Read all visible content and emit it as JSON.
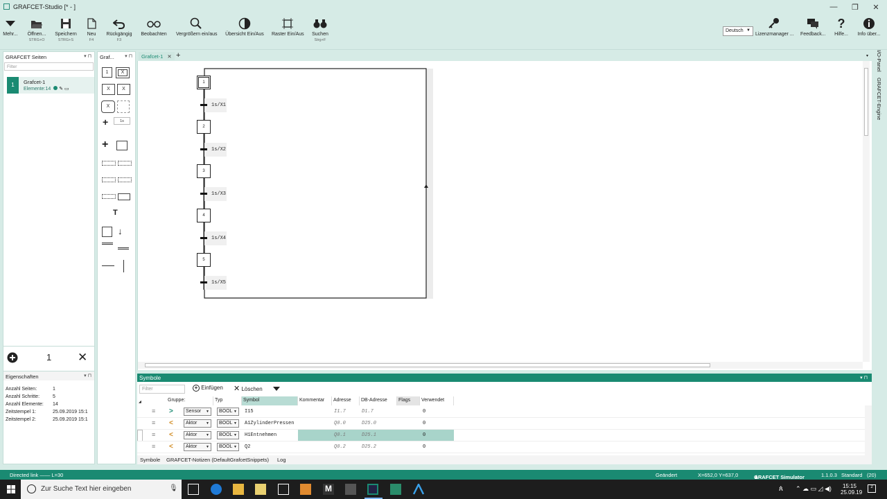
{
  "window": {
    "title": "GRAFCET-Studio [* - ]",
    "min": "—",
    "max": "❐",
    "close": "✕"
  },
  "toolbar": {
    "more": "Mehr...",
    "open": "Öffnen...",
    "open_sc": "STRG+O",
    "save": "Speichern",
    "save_sc": "STRG+S",
    "new": "Neu",
    "new_sc": "F4",
    "undo": "Rückgängig",
    "undo_sc": "F3",
    "observe": "Beobachten",
    "zoom": "Vergrößern ein/aus",
    "overview": "Übersicht Ein/Aus",
    "grid": "Raster Ein/Aus",
    "search": "Suchen",
    "search_sc": "Strg+F",
    "language": "Deutsch",
    "license": "Lizenzmanager ...",
    "feedback": "Feedback...",
    "help": "Hilfe...",
    "info": "Info über..."
  },
  "left_panel": {
    "title": "GRAFCET Seiten",
    "filter_placeholder": "Filter",
    "item_num": "1",
    "item_name": "Grafcet-1",
    "item_elements": "Elemente:14",
    "footer_count": "1"
  },
  "palette": {
    "title": "Graf...",
    "step_label": "1",
    "time_label": "1s"
  },
  "tabs": {
    "active": "Grafcet-1",
    "close": "✕",
    "add": "+"
  },
  "side_tabs": {
    "io": "I/O-Panel",
    "engine": "GRAFCET-Engine"
  },
  "grafcet": {
    "steps": [
      "1",
      "2",
      "3",
      "4",
      "5"
    ],
    "transitions": [
      "1s/X1",
      "1s/X2",
      "1s/X3",
      "1s/X4",
      "1s/X5"
    ]
  },
  "symbols": {
    "title": "Symbole",
    "filter_placeholder": "Filter",
    "insert": "Einfügen",
    "delete": "Löschen",
    "columns": [
      "Gruppe:",
      "Typ",
      "Symbol",
      "Kommentar",
      "Adresse",
      "DB-Adresse",
      "Flags",
      "Verwendet"
    ],
    "rows": [
      {
        "arrow": ">",
        "group": "Sensor",
        "type": "BOOL",
        "symbol": "I15",
        "comment": "",
        "address": "I1.7",
        "db": "D1.7",
        "flags": "",
        "used": "0"
      },
      {
        "arrow": "<",
        "group": "Aktor",
        "type": "BOOL",
        "symbol": "A1ZylinderPressen",
        "comment": "",
        "address": "Q0.0",
        "db": "D25.0",
        "flags": "",
        "used": "0"
      },
      {
        "arrow": "<",
        "group": "Aktor",
        "type": "BOOL",
        "symbol": "H1Entnehmen",
        "comment": "",
        "address": "Q0.1",
        "db": "D25.1",
        "flags": "",
        "used": "0"
      },
      {
        "arrow": "<",
        "group": "Aktor",
        "type": "BOOL",
        "symbol": "Q2",
        "comment": "",
        "address": "Q0.2",
        "db": "D25.2",
        "flags": "",
        "used": "0"
      }
    ]
  },
  "bottom_tabs": [
    "Symbole",
    "GRAFCET-Notizen (DefaultGrafcetSnippets)",
    "Log"
  ],
  "properties": {
    "title": "Eigenschaften",
    "rows": [
      {
        "k": "Anzahl Seiten:",
        "v": "1"
      },
      {
        "k": "Anzahl Schritte:",
        "v": "5"
      },
      {
        "k": "Anzahl Elemente:",
        "v": "14"
      },
      {
        "k": "Zeitstempel 1:",
        "v": "25.09.2019 15:1"
      },
      {
        "k": "Zeitstempel 2:",
        "v": "25.09.2019 15:1"
      }
    ]
  },
  "status": {
    "left": "Directed link —— L=30",
    "changed": "Geändert",
    "coords": "X=652,0 Y=637,0",
    "simulator": "GRAFCET Simulator",
    "version": "1.1.0.3",
    "mode": "Standard",
    "count": "(20)"
  },
  "taskbar": {
    "search_placeholder": "Zur Suche Text hier eingeben",
    "time": "15:15",
    "date": "25.09.19",
    "notif": "2"
  }
}
